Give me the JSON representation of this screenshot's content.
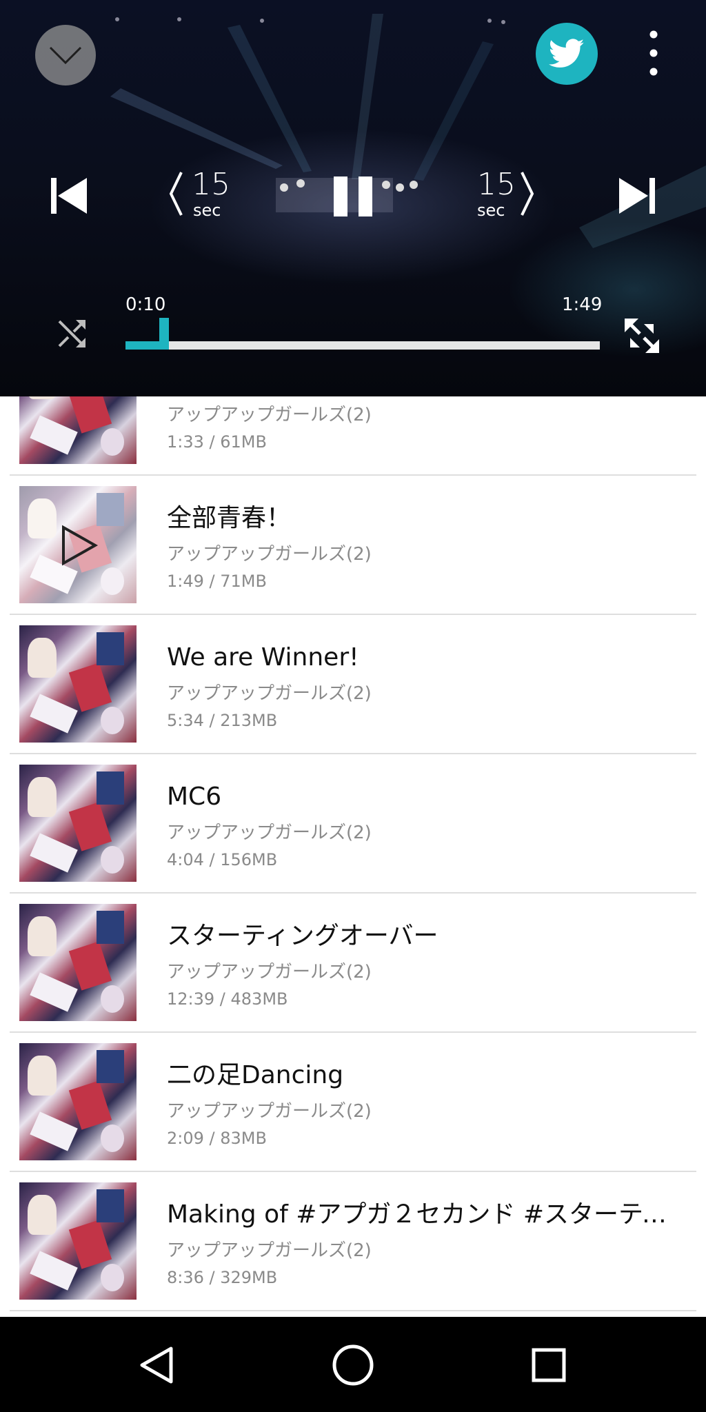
{
  "player": {
    "skip_back": {
      "amount": "15",
      "unit": "sec"
    },
    "skip_forward": {
      "amount": "15",
      "unit": "sec"
    },
    "current_time": "0:10",
    "total_time": "1:49",
    "progress_fraction": 0.092,
    "accent_color": "#1eb4c0",
    "icons": {
      "collapse": "chevron-down-icon",
      "share": "twitter-icon",
      "more": "more-vertical-icon",
      "previous": "skip-previous-icon",
      "pause": "pause-icon",
      "next": "skip-next-icon",
      "shuffle": "shuffle-icon",
      "fullscreen": "fullscreen-icon"
    }
  },
  "tracks": [
    {
      "title": "",
      "artist": "アップアップガールズ(2)",
      "meta": "1:33 / 61MB"
    },
    {
      "title": "全部青春！",
      "artist": "アップアップガールズ(2)",
      "meta": "1:49 / 71MB",
      "playing": true
    },
    {
      "title": "We are Winner!",
      "artist": "アップアップガールズ(2)",
      "meta": "5:34 / 213MB"
    },
    {
      "title": "MC6",
      "artist": "アップアップガールズ(2)",
      "meta": "4:04 / 156MB"
    },
    {
      "title": "スターティングオーバー",
      "artist": "アップアップガールズ(2)",
      "meta": "12:39 / 483MB"
    },
    {
      "title": "二の足Dancing",
      "artist": "アップアップガールズ(2)",
      "meta": "2:09 / 83MB"
    },
    {
      "title": "Making of #アプガ２セカンド #スターティ…",
      "artist": "アップアップガールズ(2)",
      "meta": "8:36 / 329MB"
    }
  ],
  "navbar": {
    "icons": [
      "back-icon",
      "home-icon",
      "recents-icon"
    ]
  }
}
